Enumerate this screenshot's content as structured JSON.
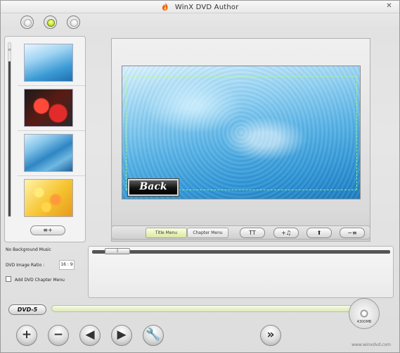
{
  "window": {
    "title": "WinX DVD Author",
    "close_label": "✕"
  },
  "left_panel": {
    "backgrounds": [
      "blue ripple background",
      "red flowers background",
      "blue wave background",
      "yellow flowers background"
    ],
    "add_button_label": "≡+"
  },
  "preview": {
    "back_button_label": "Back"
  },
  "menu_bar": {
    "tab_title_menu": "Title Menu",
    "tab_chapter_menu": "Chapter Menu",
    "text_button_label": "TT",
    "music_button_label": "+♫",
    "up_button_label": "⬆",
    "remove_button_label": "−≡"
  },
  "settings": {
    "no_music": "No Background Music",
    "ratio_label": "DVD Image Ratio :",
    "ratio_value": "16 : 9",
    "chapter_menu_label": "Add DVD Chapter Menu",
    "chapter_menu_checked": false
  },
  "capacity": {
    "dvd_type": "DVD-5",
    "disc_label": "4300MB"
  },
  "bottom_toolbar": {
    "add": "+",
    "remove": "−",
    "back": "◀",
    "forward": "▶",
    "settings": "🔧",
    "next": "»"
  },
  "footer": {
    "url": "www.winxdvd.com"
  },
  "colors": {
    "accent_green": "#cbe52e",
    "panel_border": "#b0b0b0",
    "preview_blue": "#56b2e6"
  }
}
